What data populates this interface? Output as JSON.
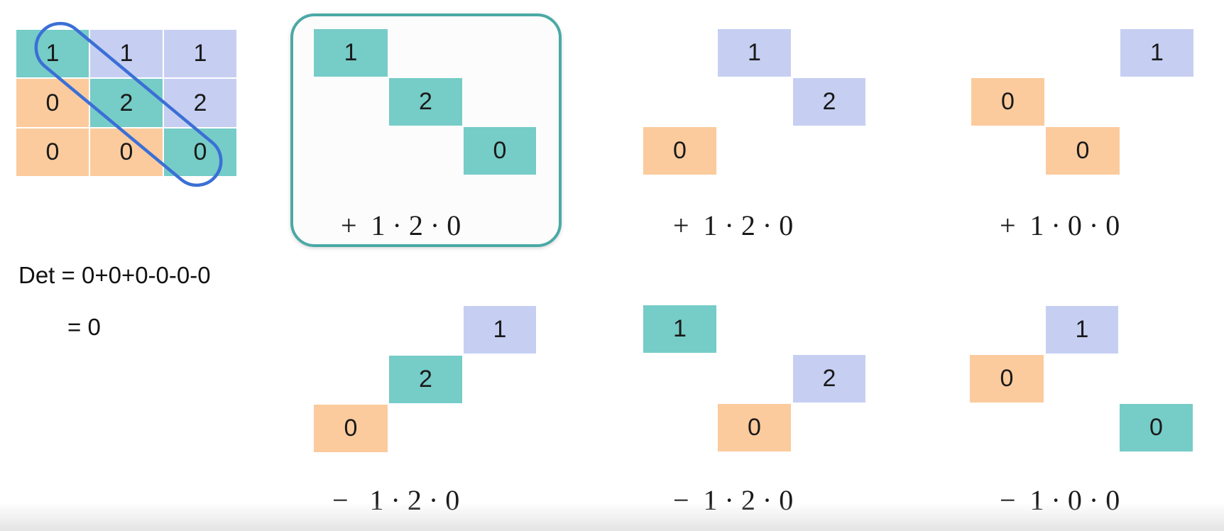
{
  "matrix": [
    [
      "1",
      "1",
      "1"
    ],
    [
      "0",
      "2",
      "2"
    ],
    [
      "0",
      "0",
      "0"
    ]
  ],
  "determinant": {
    "line1": "Det = 0+0+0-0-0-0",
    "line2": "= 0"
  },
  "terms": [
    {
      "cells": [
        "1",
        "2",
        "0"
      ],
      "label": "+  1 · 2 · 0"
    },
    {
      "cells": [
        "1",
        "2",
        "0"
      ],
      "label": "+  1 · 2 · 0"
    },
    {
      "cells": [
        "1",
        "0",
        "0"
      ],
      "label": "+  1 · 0 · 0"
    },
    {
      "cells": [
        "1",
        "2",
        "0"
      ],
      "label": "−   1 · 2 · 0"
    },
    {
      "cells": [
        "1",
        "2",
        "0"
      ],
      "label": "−  1 · 2 · 0"
    },
    {
      "cells": [
        "1",
        "0",
        "0"
      ],
      "label": "−  1 · 0 · 0"
    }
  ],
  "colors": {
    "teal": "#76ccc7",
    "lavender": "#c6cff2",
    "peach": "#fbcb9d",
    "highlight_border": "#4aa9a5",
    "diagonal_outline": "#3b6fd6"
  }
}
